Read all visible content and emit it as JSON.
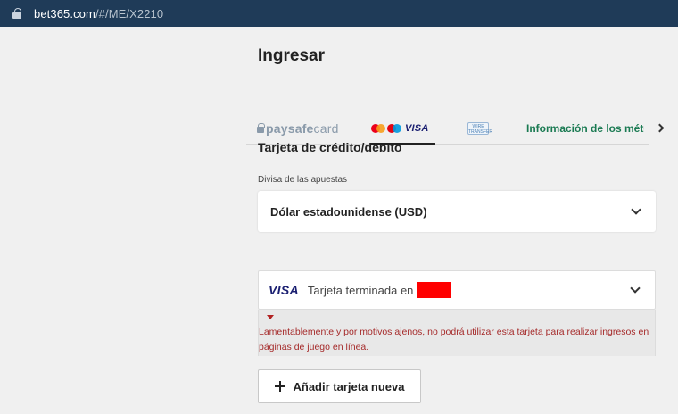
{
  "browser": {
    "url_host": "bet365.com",
    "url_path": "/#/ME/X2210"
  },
  "page": {
    "title": "Ingresar"
  },
  "tabs": [
    {
      "id": "paysafecard",
      "logo_text_bold": "paysafe",
      "logo_text_rest": "card",
      "icon": "paysafecard-lock-icon"
    },
    {
      "id": "cards",
      "logo_text": "VISA",
      "icons": [
        "mastercard-icon",
        "maestro-icon"
      ],
      "selected": true
    },
    {
      "id": "wire",
      "logo_text": "WIRE TRANSFER",
      "icon": "wire-transfer-icon"
    },
    {
      "id": "info",
      "label": "Información de los méto"
    }
  ],
  "section": {
    "title": "Tarjeta de crédito/débito",
    "currency_label": "Divisa de las apuestas",
    "currency_value": "Dólar estadounidense (USD)"
  },
  "card": {
    "brand": "VISA",
    "label": "Tarjeta terminada en",
    "error": "Lamentablemente y por motivos ajenos, no podrá utilizar esta tarjeta para realizar ingresos en páginas de juego en línea."
  },
  "actions": {
    "add_card_label": "Añadir tarjeta nueva"
  },
  "colors": {
    "address_bar": "#1f3b58",
    "info_tab": "#1a7a52",
    "error_text": "#a52a2a",
    "redaction": "#ff0000"
  }
}
